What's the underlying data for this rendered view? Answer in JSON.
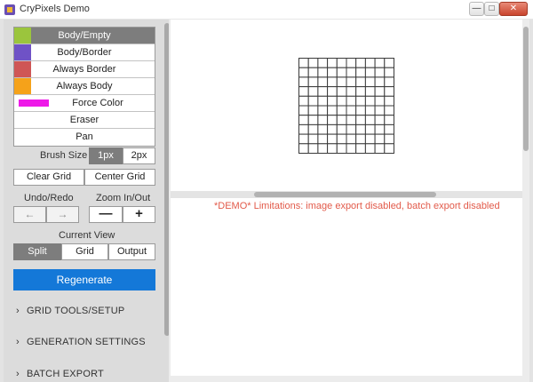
{
  "window": {
    "title": "CryPixels Demo",
    "min_glyph": "—",
    "max_glyph": "□",
    "close_glyph": "✕"
  },
  "layers": [
    {
      "label": "Body/Empty",
      "color": "#9bc53d",
      "selected": true
    },
    {
      "label": "Body/Border",
      "color": "#6f52c6",
      "selected": false
    },
    {
      "label": "Always Border",
      "color": "#cf5656",
      "selected": false
    },
    {
      "label": "Always Body",
      "color": "#f5a21a",
      "selected": false
    },
    {
      "label": "Force Color",
      "color": "#ee19e8",
      "selected": false
    },
    {
      "label": "Eraser",
      "selected": false
    },
    {
      "label": "Pan",
      "selected": false
    }
  ],
  "brush": {
    "label": "Brush Size",
    "options": [
      "1px",
      "2px"
    ],
    "selected": "1px"
  },
  "grid_buttons": {
    "clear": "Clear Grid",
    "center": "Center Grid"
  },
  "undo_redo": {
    "label": "Undo/Redo",
    "undo_glyph": "←",
    "redo_glyph": "→"
  },
  "zoom": {
    "label": "Zoom In/Out",
    "out_glyph": "—",
    "in_glyph": "+"
  },
  "view": {
    "label": "Current View",
    "options": [
      "Split",
      "Grid",
      "Output"
    ],
    "selected": "Split"
  },
  "regenerate_label": "Regenerate",
  "sections": [
    {
      "label": "GRID TOOLS/SETUP"
    },
    {
      "label": "GENERATION SETTINGS"
    },
    {
      "label": "BATCH EXPORT"
    }
  ],
  "demo_notice": "*DEMO* Limitations: image export disabled, batch export disabled",
  "grid": {
    "columns": 10,
    "rows": 10,
    "line_color": "#3a3a3a"
  },
  "colors": {
    "accent": "#1478d8",
    "selected_bg": "#7d7d7d",
    "notice": "#e25a4a"
  }
}
